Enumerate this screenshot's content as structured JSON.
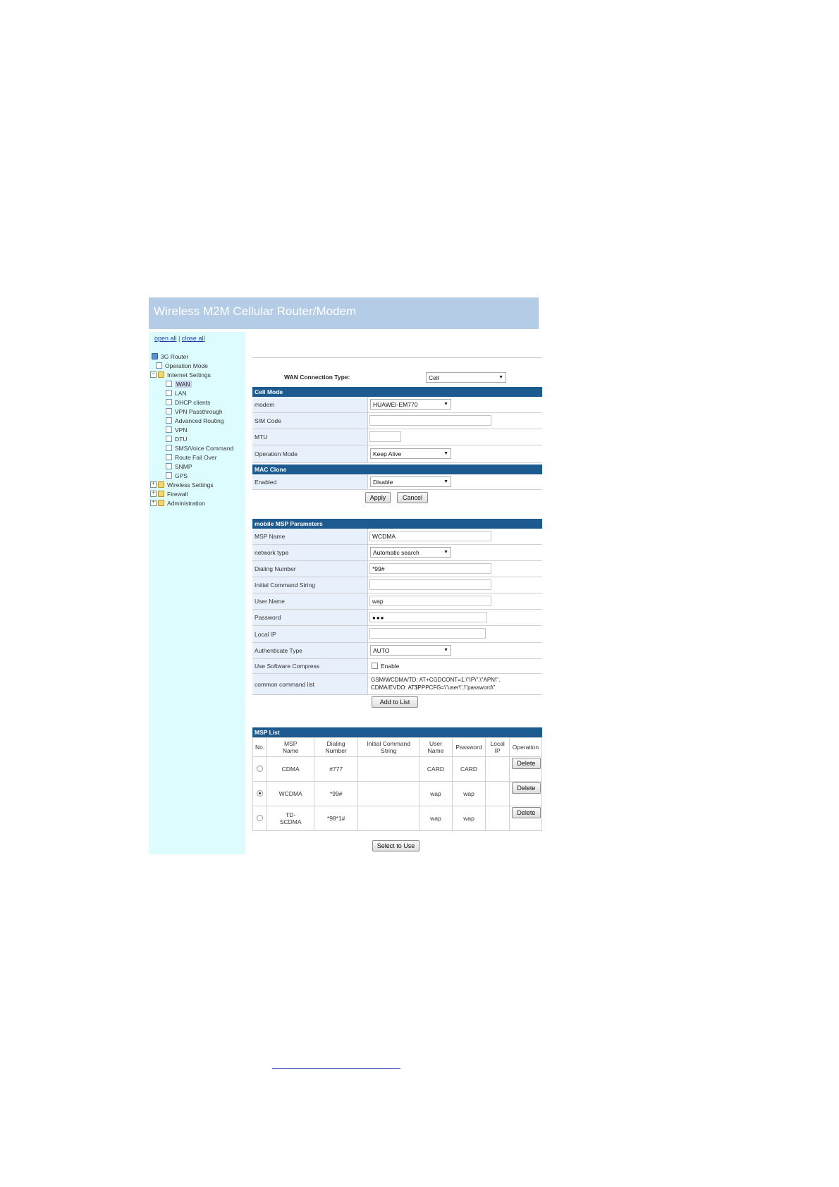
{
  "app_title": "Wireless M2M Cellular Router/Modem",
  "sidebar": {
    "open_all": "open all",
    "separator": "|",
    "close_all": "close all",
    "tree": [
      {
        "label": "3G Router"
      },
      {
        "label": "Operation Mode"
      },
      {
        "label": "Internet Settings"
      },
      {
        "label": "WAN"
      },
      {
        "label": "LAN"
      },
      {
        "label": "DHCP clients"
      },
      {
        "label": "VPN Passthrough"
      },
      {
        "label": "Advanced Routing"
      },
      {
        "label": "VPN"
      },
      {
        "label": "DTU"
      },
      {
        "label": "SMS/Voice Command"
      },
      {
        "label": "Route Fail Over"
      },
      {
        "label": "SNMP"
      },
      {
        "label": "GPS"
      },
      {
        "label": "Wireless Settings"
      },
      {
        "label": "Firewall"
      },
      {
        "label": "Administration"
      }
    ],
    "selected_item": "WAN"
  },
  "wan": {
    "connection_type_label": "WAN Connection Type:",
    "connection_type_value": "Cell"
  },
  "cell_mode": {
    "header": "Cell Mode",
    "modem_label": "modem",
    "modem_value": "HUAWEI-EM770",
    "sim_code_label": "SIM Code",
    "sim_code_value": "",
    "mtu_label": "MTU",
    "mtu_value": "",
    "operation_mode_label": "Operation Mode",
    "operation_mode_value": "Keep Alive"
  },
  "mac_clone": {
    "header": "MAC Clone",
    "enabled_label": "Enabled",
    "enabled_value": "Disable",
    "apply_label": "Apply",
    "cancel_label": "Cancel"
  },
  "msp_params": {
    "header": "mobile MSP Parameters",
    "msp_name_label": "MSP Name",
    "msp_name_value": "WCDMA",
    "network_type_label": "network type",
    "network_type_value": "Automatic search",
    "dialing_number_label": "Dialing Number",
    "dialing_number_value": "*99#",
    "initial_command_label": "Initial Command String",
    "initial_command_value": "",
    "user_name_label": "User Name",
    "user_name_value": "wap",
    "password_label": "Password",
    "password_value": "●●●",
    "local_ip_label": "Local IP",
    "local_ip_value": "",
    "auth_type_label": "Authenticate Type",
    "auth_type_value": "AUTO",
    "compress_label": "Use Software Compress",
    "compress_checkbox_label": "Enable",
    "common_command_label": "common command list",
    "common_command_line1": "GSM/WCDMA/TD: AT+CGDCONT=1,\\\"IP\\\",\\\"APN\\\",",
    "common_command_line2": "CDMA/EVDO: AT$PPPCFG=\\\"user\\\",\\\"password\\\"",
    "add_to_list_label": "Add to List"
  },
  "msp_list": {
    "header": "MSP List",
    "columns": {
      "no": "No.",
      "msp_name_1": "MSP",
      "msp_name_2": "Name",
      "dialing_1": "Dialing",
      "dialing_2": "Number",
      "initial_1": "Initial Command",
      "initial_2": "String",
      "user_1": "User",
      "user_2": "Name",
      "password": "Password",
      "local_1": "Local",
      "local_2": "IP",
      "operation": "Operation"
    },
    "rows": [
      {
        "msp_name": "CDMA",
        "dialing_number": "#777",
        "initial_command": "",
        "user_name": "CARD",
        "password": "CARD",
        "local_ip": "",
        "selected": false,
        "delete_label": "Delete"
      },
      {
        "msp_name": "WCDMA",
        "dialing_number": "*99#",
        "initial_command": "",
        "user_name": "wap",
        "password": "wap",
        "local_ip": "",
        "selected": true,
        "delete_label": "Delete"
      },
      {
        "msp_name_1": "TD-",
        "msp_name_2": "SCDMA",
        "dialing_number": "*98*1#",
        "initial_command": "",
        "user_name": "wap",
        "password": "wap",
        "local_ip": "",
        "selected": false,
        "delete_label": "Delete"
      }
    ],
    "select_to_use_label": "Select to Use"
  }
}
